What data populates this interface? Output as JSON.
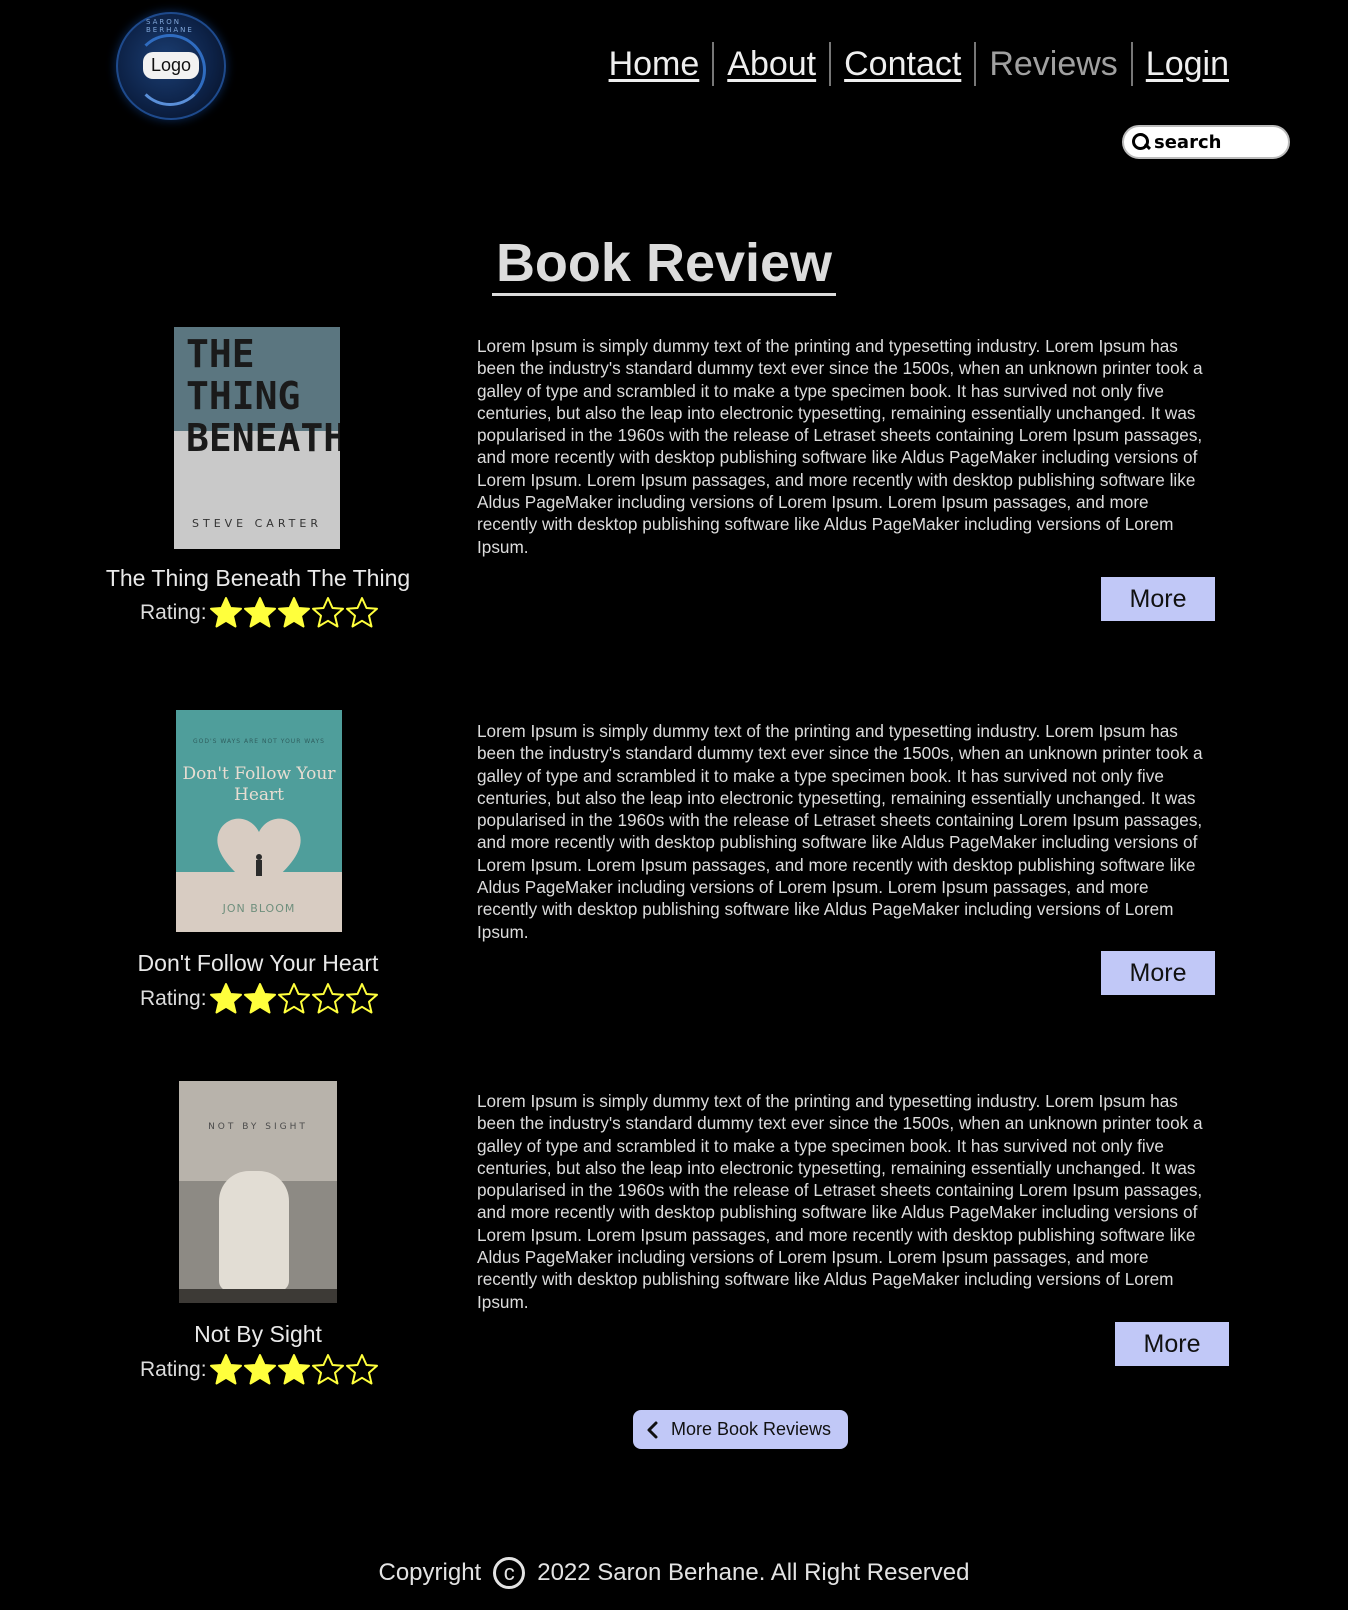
{
  "header": {
    "logo_label": "Logo",
    "logo_ring_text": "SARON BERHANE",
    "nav": [
      {
        "label": "Home",
        "active": false
      },
      {
        "label": "About",
        "active": false
      },
      {
        "label": "Contact",
        "active": false
      },
      {
        "label": "Reviews",
        "active": true
      },
      {
        "label": "Login",
        "active": false
      }
    ],
    "search_placeholder": "search"
  },
  "page_title": "Book Review",
  "reviews": [
    {
      "title": "The Thing Beneath The Thing",
      "rating_label": "Rating:",
      "rating": 3,
      "rating_max": 5,
      "cover": {
        "title": "THE THING BENEATH",
        "author": "STEVE CARTER"
      },
      "text": "Lorem Ipsum is simply dummy text of the printing and typesetting industry. Lorem Ipsum has been the industry's standard dummy text ever since the 1500s, when an unknown printer took a galley of type and scrambled it to make a type specimen book. It has survived not only five centuries, but also the leap into electronic typesetting, remaining essentially unchanged. It was popularised in the 1960s with the release of Letraset sheets containing Lorem Ipsum passages, and more recently with desktop publishing software like Aldus PageMaker including versions of Lorem Ipsum. Lorem Ipsum passages, and more recently with desktop publishing software like Aldus PageMaker including versions of Lorem Ipsum. Lorem Ipsum passages, and more recently with desktop publishing software like Aldus PageMaker including versions of Lorem Ipsum.",
      "more_label": "More"
    },
    {
      "title": "Don't Follow Your Heart",
      "rating_label": "Rating:",
      "rating": 2,
      "rating_max": 5,
      "cover": {
        "kicker": "GOD'S WAYS ARE NOT YOUR WAYS",
        "title": "Don't Follow Your Heart",
        "author": "JON BLOOM"
      },
      "text": "Lorem Ipsum is simply dummy text of the printing and typesetting industry. Lorem Ipsum has been the industry's standard dummy text ever since the 1500s, when an unknown printer took a galley of type and scrambled it to make a type specimen book. It has survived not only five centuries, but also the leap into electronic typesetting, remaining essentially unchanged. It was popularised in the 1960s with the release of Letraset sheets containing Lorem Ipsum passages, and more recently with desktop publishing software like Aldus PageMaker including versions of Lorem Ipsum. Lorem Ipsum passages, and more recently with desktop publishing software like Aldus PageMaker including versions of Lorem Ipsum. Lorem Ipsum passages, and more recently with desktop publishing software like Aldus PageMaker including versions of Lorem Ipsum.",
      "more_label": "More"
    },
    {
      "title": "Not By Sight",
      "rating_label": "Rating:",
      "rating": 3,
      "rating_max": 5,
      "cover": {
        "title": "NOT BY SIGHT"
      },
      "text": "Lorem Ipsum is simply dummy text of the printing and typesetting industry. Lorem Ipsum has been the industry's standard dummy text ever since the 1500s, when an unknown printer took a galley of type and scrambled it to make a type specimen book. It has survived not only five centuries, but also the leap into electronic typesetting, remaining essentially unchanged. It was popularised in the 1960s with the release of Letraset sheets containing Lorem Ipsum passages, and more recently with desktop publishing software like Aldus PageMaker including versions of Lorem Ipsum. Lorem Ipsum passages, and more recently with desktop publishing software like Aldus PageMaker including versions of Lorem Ipsum. Lorem Ipsum passages, and more recently with desktop publishing software like Aldus PageMaker including versions of Lorem Ipsum.",
      "more_label": "More"
    }
  ],
  "more_reviews_label": "More Book Reviews",
  "footer": {
    "prefix": "Copyright",
    "icon": "copyright-icon",
    "text": "2022 Saron Berhane. All Right Reserved"
  },
  "colors": {
    "background": "#000000",
    "button": "#c1c8f7",
    "star": "#ffff3c"
  }
}
